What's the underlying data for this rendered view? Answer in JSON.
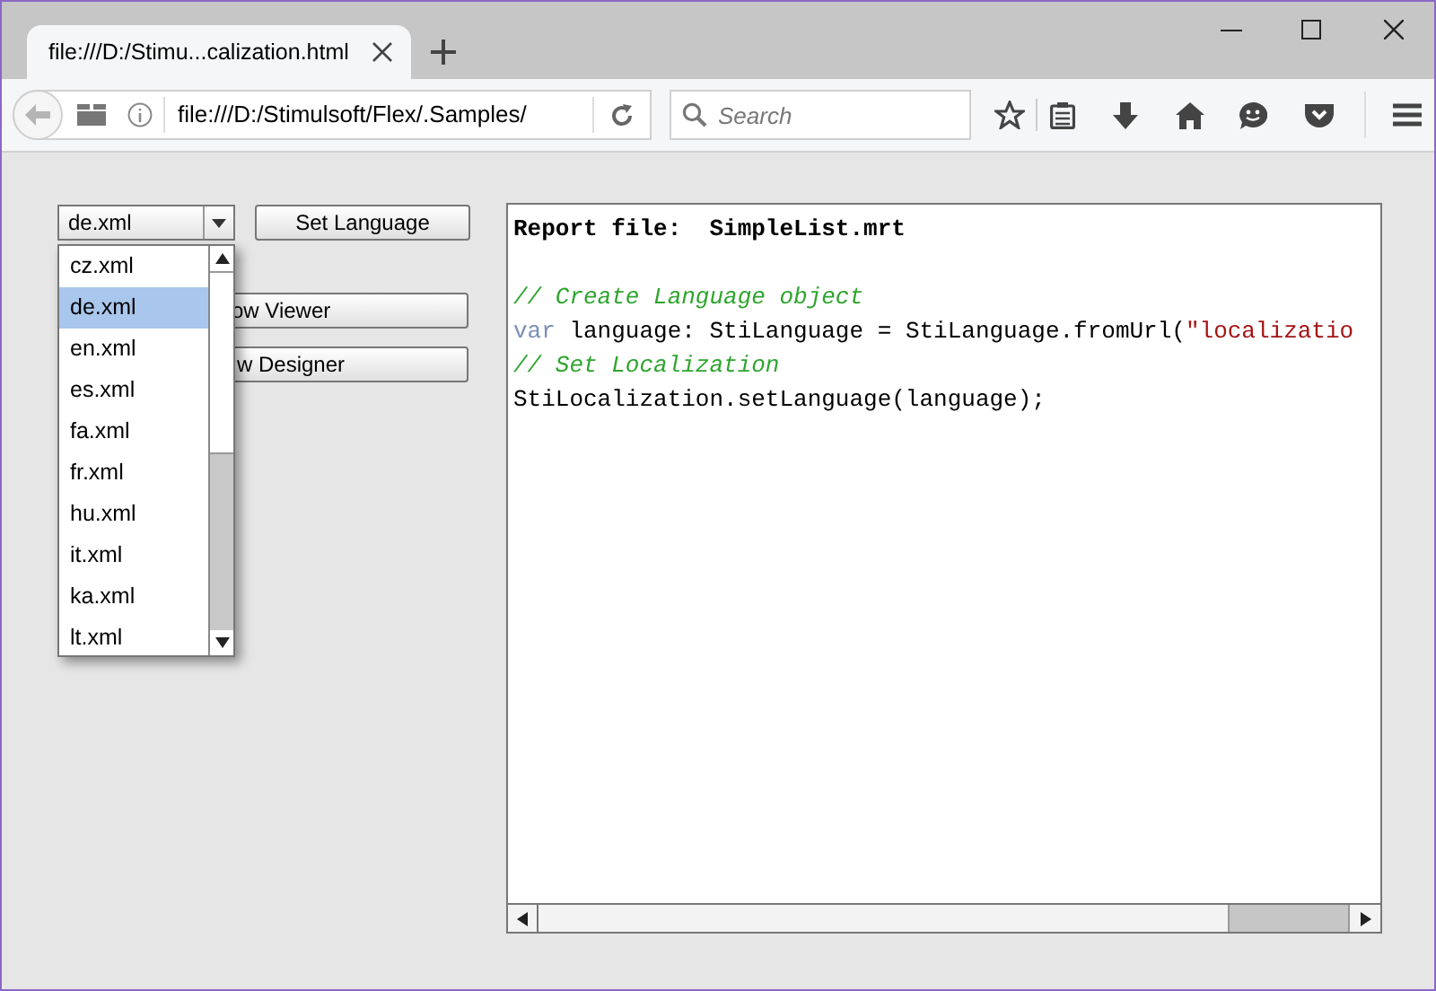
{
  "window": {
    "tab_title": "file:///D:/Stimu...calization.html",
    "url": "file:///D:/Stimulsoft/Flex/.Samples/",
    "search": {
      "placeholder": "Search"
    }
  },
  "language_combo": {
    "value": "de.xml",
    "expanded": true,
    "options": [
      {
        "label": "cz.xml",
        "selected": false
      },
      {
        "label": "de.xml",
        "selected": true
      },
      {
        "label": "en.xml",
        "selected": false
      },
      {
        "label": "es.xml",
        "selected": false
      },
      {
        "label": "fa.xml",
        "selected": false
      },
      {
        "label": "fr.xml",
        "selected": false
      },
      {
        "label": "hu.xml",
        "selected": false
      },
      {
        "label": "it.xml",
        "selected": false
      },
      {
        "label": "ka.xml",
        "selected": false
      },
      {
        "label": "lt.xml",
        "selected": false
      }
    ]
  },
  "buttons": [
    {
      "label": "Set Language"
    },
    {
      "label": "ow Viewer"
    },
    {
      "label": "w Designer"
    }
  ],
  "code": {
    "lines": [
      {
        "kind": "code",
        "segments": [
          {
            "text": "Report file:  SimpleList.mrt",
            "kind": "bold"
          }
        ]
      },
      {
        "kind": "blank"
      },
      {
        "kind": "code",
        "segments": [
          {
            "text": "// Create Language object",
            "kind": "comment"
          }
        ]
      },
      {
        "kind": "code",
        "segments": [
          {
            "text": "var",
            "kind": "keyword"
          },
          {
            "text": " language: StiLanguage = StiLanguage.fromUrl(",
            "kind": "plain"
          },
          {
            "text": "\"localizatio",
            "kind": "string"
          }
        ]
      },
      {
        "kind": "code",
        "segments": [
          {
            "text": "// Set Localization",
            "kind": "comment"
          }
        ]
      },
      {
        "kind": "code",
        "segments": [
          {
            "text": "StiLocalization.setLanguage(language);",
            "kind": "plain"
          }
        ]
      }
    ]
  }
}
